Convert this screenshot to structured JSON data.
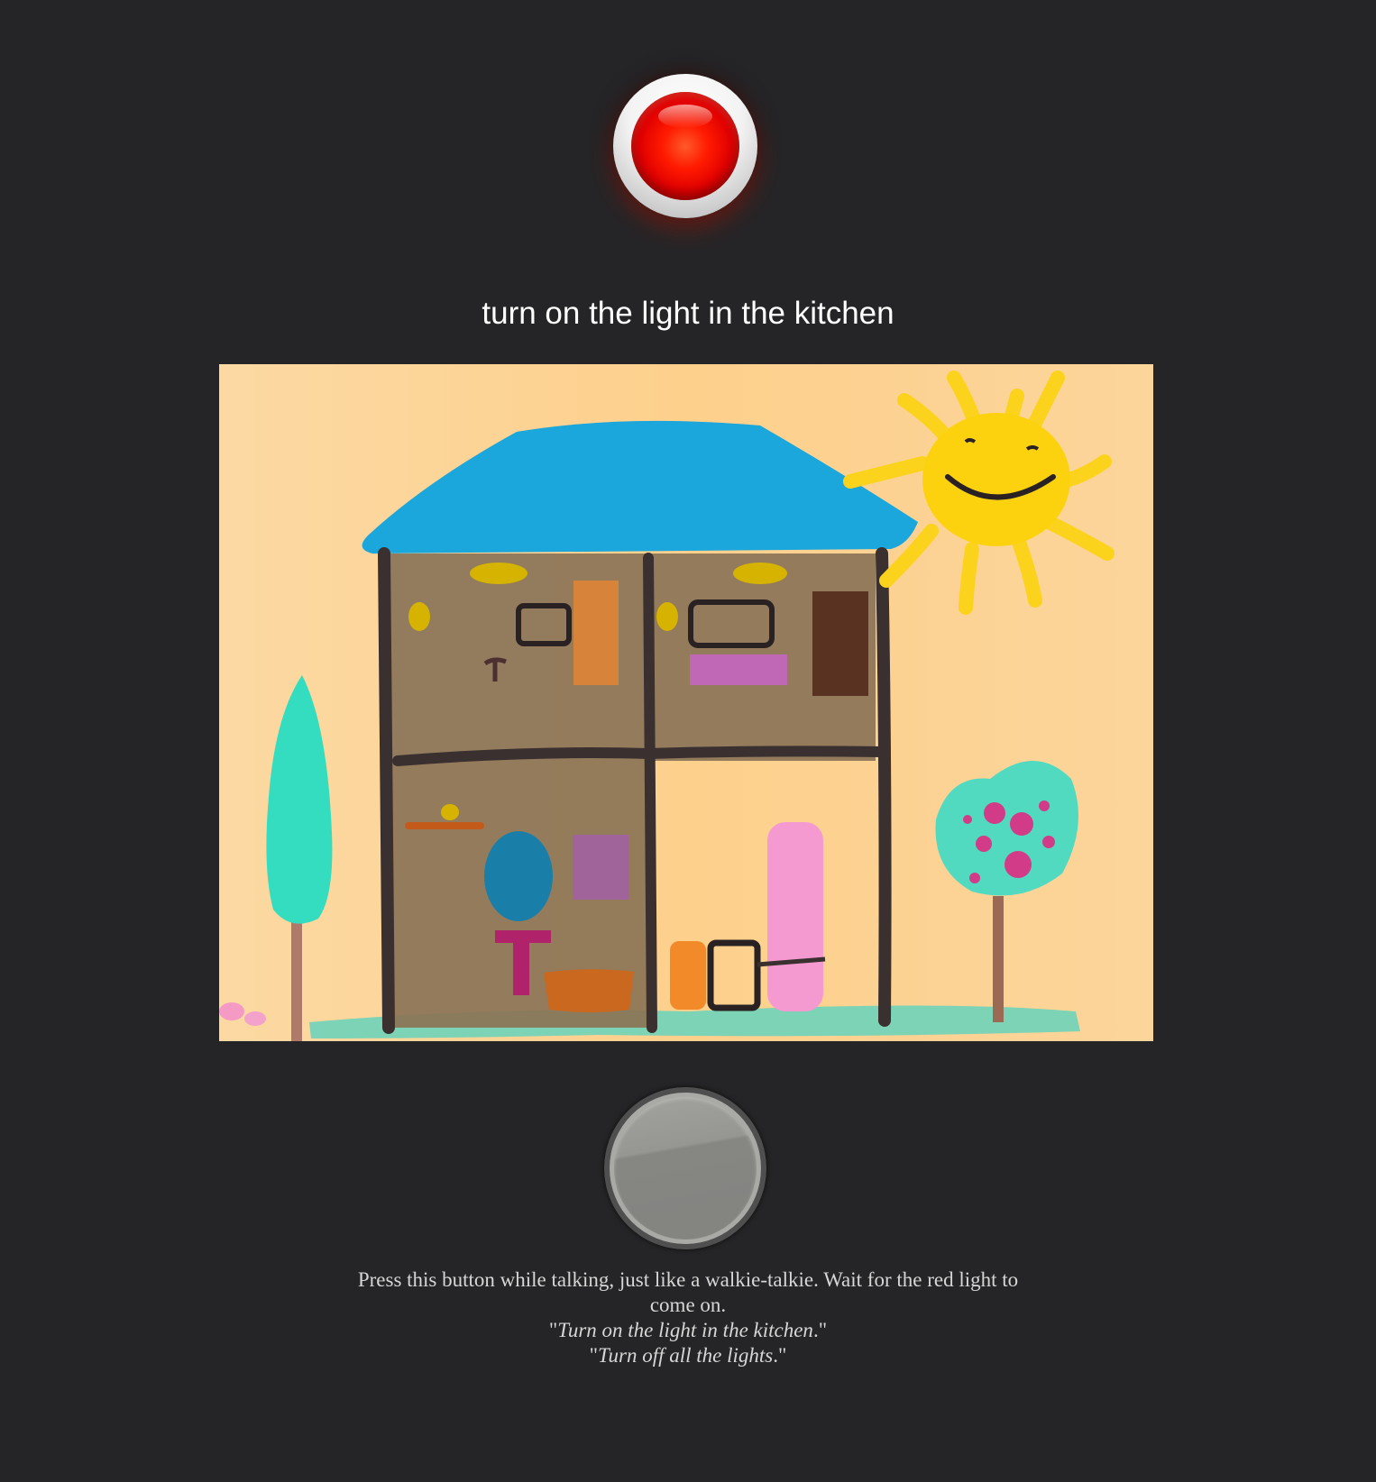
{
  "transcript": {
    "text": "turn on the light in the kitchen"
  },
  "indicator": {
    "name": "recording-light",
    "state": "on",
    "color": "#ff1a00"
  },
  "talk_button": {
    "name": "push-to-talk"
  },
  "instructions": {
    "line1": "Press this button while talking, just like a walkie-talkie. Wait for the red light to come on.",
    "example1_open": "\"",
    "example1_text": "Turn on the light in the kitchen",
    "example1_close": ".\"",
    "example2_open": "\"",
    "example2_text": "Turn off all the lights",
    "example2_close": ".\""
  },
  "colors": {
    "background": "#252527",
    "transcript_text": "#ffffff",
    "instruction_text": "#d6d6d6"
  }
}
